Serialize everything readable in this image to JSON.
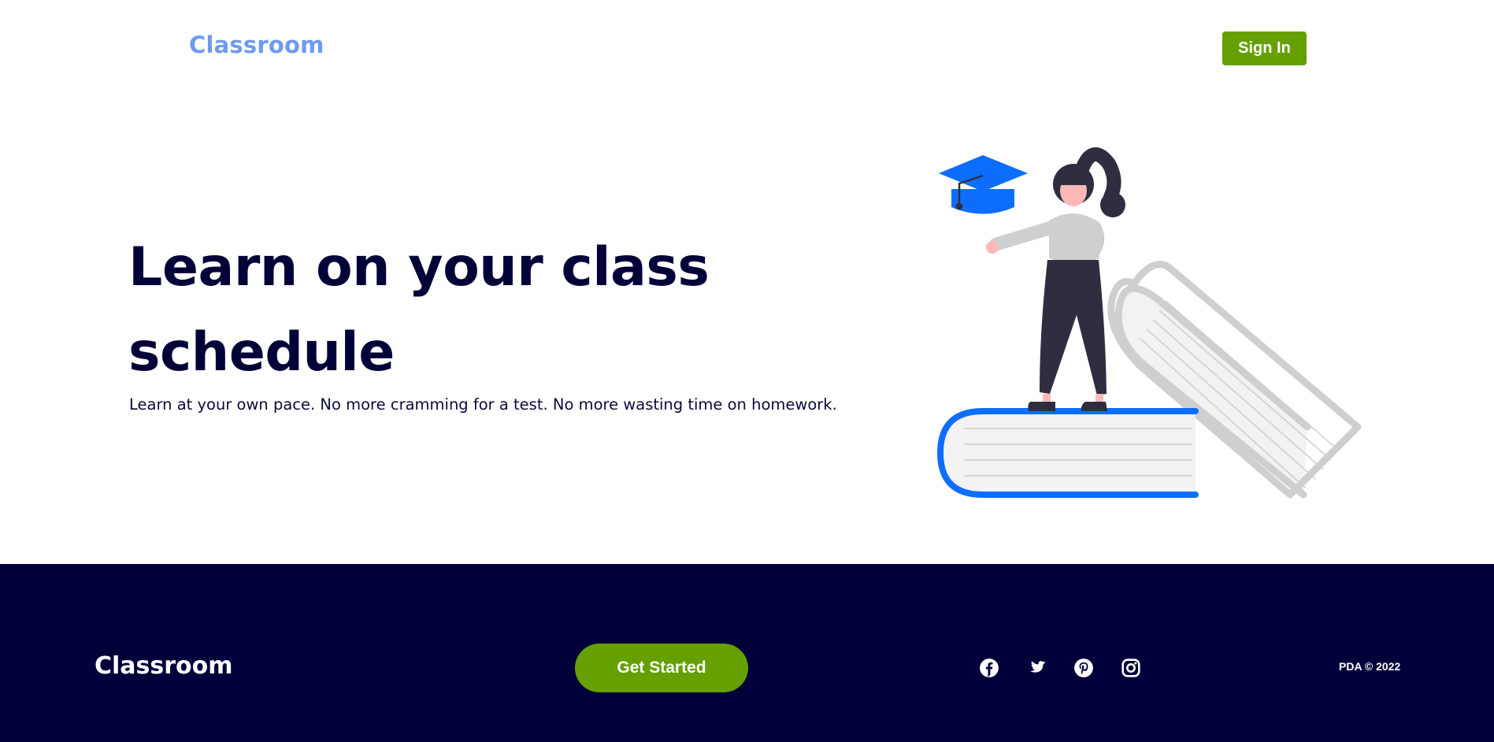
{
  "header": {
    "brand": "Classroom",
    "sign_in_label": "Sign In"
  },
  "hero": {
    "title_line1": "Learn on your class",
    "title_line2": "schedule",
    "subtitle": "Learn at your own pace. No more cramming for a test. No more wasting time on homework.",
    "illustration": "student-on-books-illustration"
  },
  "footer": {
    "brand": "Classroom",
    "cta_label": "Get Started",
    "social_icons": [
      "facebook-icon",
      "twitter-icon",
      "pinterest-icon",
      "instagram-icon"
    ],
    "copyright": "PDA © 2022"
  },
  "colors": {
    "brand_blue": "#6d9bf0",
    "accent_green": "#65a000",
    "navy": "#00003a",
    "title_navy": "#020238",
    "illustration_blue": "#0d6efd"
  }
}
